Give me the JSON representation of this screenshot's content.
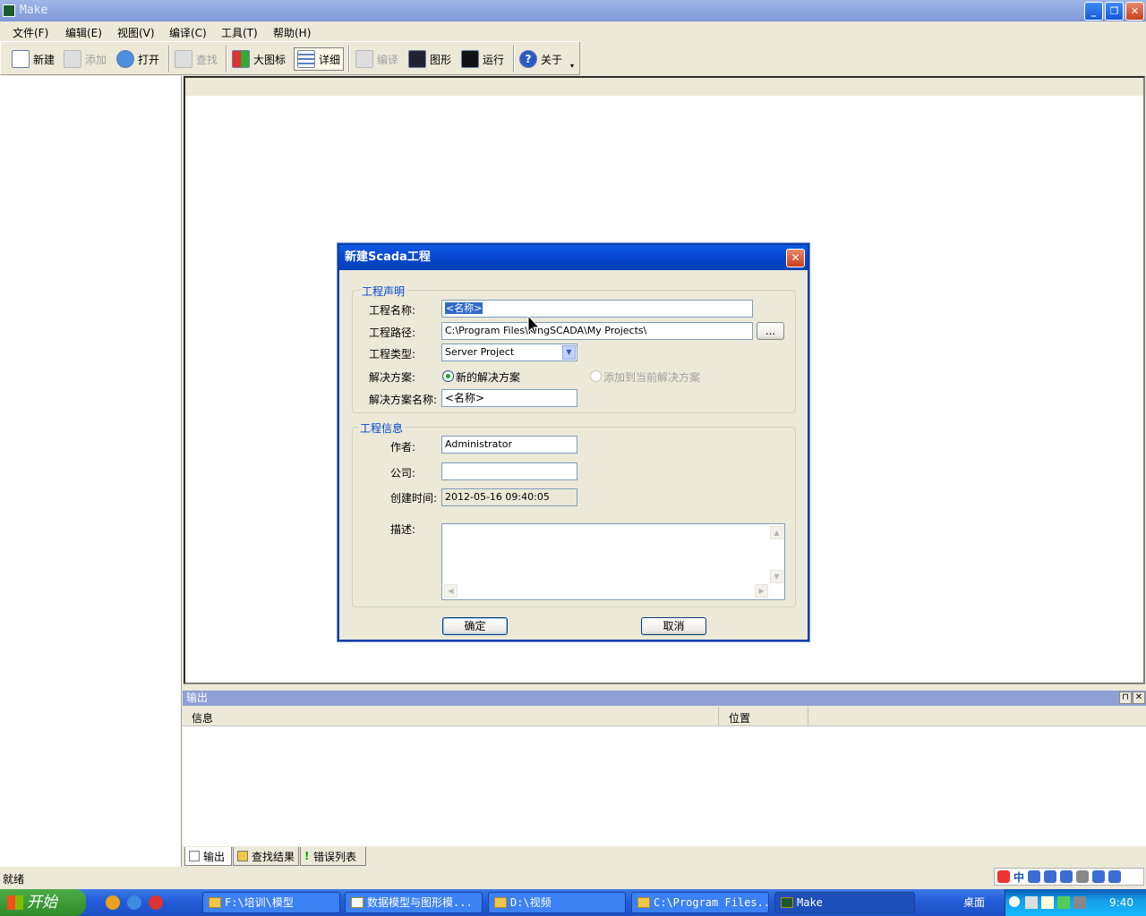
{
  "window": {
    "title": "Make"
  },
  "menu": [
    "文件(F)",
    "编辑(E)",
    "视图(V)",
    "编译(C)",
    "工具(T)",
    "帮助(H)"
  ],
  "toolbar": {
    "new": "新建",
    "add": "添加",
    "open": "打开",
    "find": "查找",
    "large_icons": "大图标",
    "details": "详细",
    "compile": "编译",
    "graphics": "图形",
    "run": "运行",
    "about": "关于"
  },
  "output": {
    "title": "输出",
    "columns": [
      "信息",
      "位置"
    ],
    "tabs": [
      "输出",
      "查找结果",
      "错误列表"
    ]
  },
  "status": {
    "text": "就绪"
  },
  "dialog": {
    "title": "新建Scada工程",
    "group1": "工程声明",
    "name_label": "工程名称:",
    "name_value": "<名称>",
    "path_label": "工程路径:",
    "path_value": "C:\\Program Files\\KingSCADA\\My Projects\\",
    "browse": "...",
    "type_label": "工程类型:",
    "type_value": "Server Project",
    "solution_label": "解决方案:",
    "solution_new": "新的解决方案",
    "solution_add": "添加到当前解决方案",
    "solution_name_label": "解决方案名称:",
    "solution_name_value": "<名称>",
    "group2": "工程信息",
    "author_label": "作者:",
    "author_value": "Administrator",
    "company_label": "公司:",
    "company_value": "",
    "created_label": "创建时间:",
    "created_value": "2012-05-16 09:40:05",
    "desc_label": "描述:",
    "ok": "确定",
    "cancel": "取消"
  },
  "taskbar": {
    "start": "开始",
    "tasks": [
      "F:\\培训\\模型",
      "数据模型与图形模...",
      "D:\\视频",
      "C:\\Program Files...",
      "Make"
    ],
    "desktop": "桌面",
    "clock": "9:40"
  },
  "ime": {
    "mode": "中"
  }
}
